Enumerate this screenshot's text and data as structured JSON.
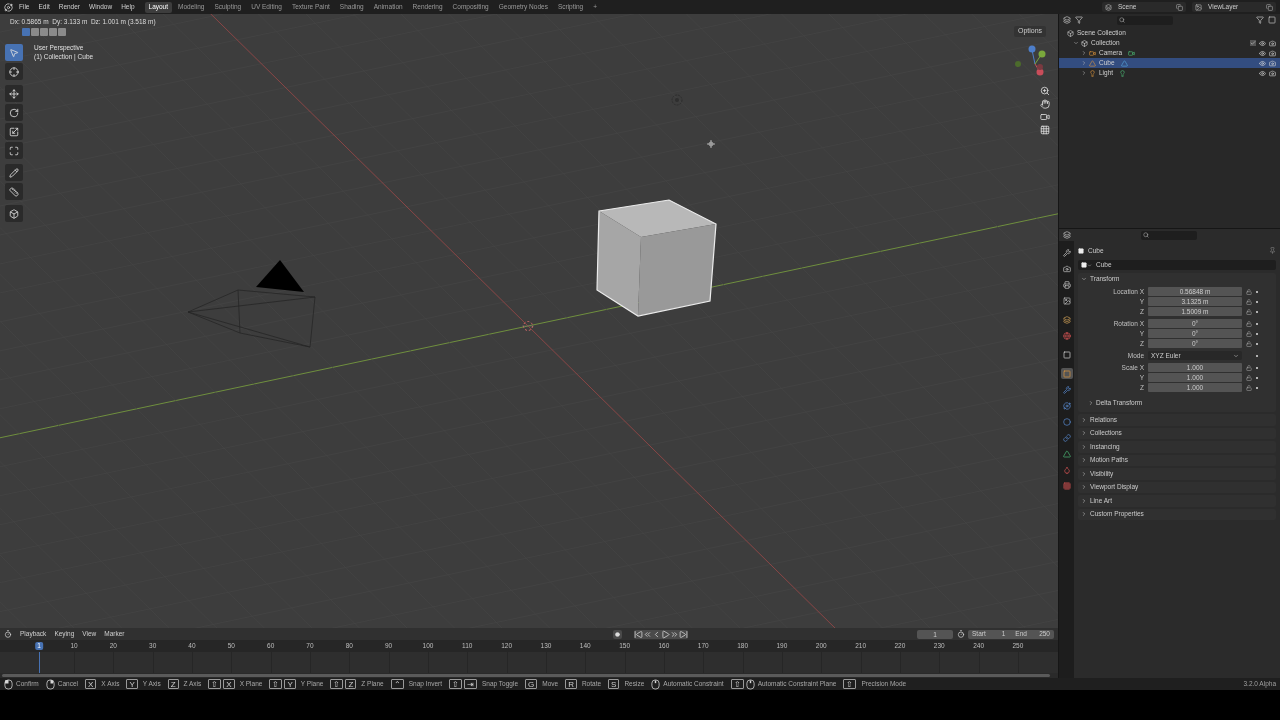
{
  "menu": [
    "File",
    "Edit",
    "Render",
    "Window",
    "Help"
  ],
  "workspaces": [
    {
      "label": "Layout",
      "selected": true
    },
    {
      "label": "Modeling",
      "selected": false
    },
    {
      "label": "Sculpting",
      "selected": false
    },
    {
      "label": "UV Editing",
      "selected": false
    },
    {
      "label": "Texture Paint",
      "selected": false
    },
    {
      "label": "Shading",
      "selected": false
    },
    {
      "label": "Animation",
      "selected": false
    },
    {
      "label": "Rendering",
      "selected": false
    },
    {
      "label": "Compositing",
      "selected": false
    },
    {
      "label": "Geometry Nodes",
      "selected": false
    },
    {
      "label": "Scripting",
      "selected": false
    },
    {
      "label": "+",
      "selected": false
    }
  ],
  "scene": "Scene",
  "view_layer": "ViewLayer",
  "viewport": {
    "header_text": "Dx: 0.5865 m  Dy: 3.133 m  Dz: 1.001 m (3.518 m)",
    "perspective": "User Perspective",
    "context": "(1) Collection | Cube",
    "options": "Options",
    "modes": [
      {
        "selected": true
      },
      {
        "selected": false
      },
      {
        "selected": false
      },
      {
        "selected": false
      },
      {
        "selected": false
      }
    ],
    "tools": [
      {
        "kind": "select",
        "selected": true
      },
      {
        "kind": "cursor",
        "selected": false
      },
      {
        "kind": "move",
        "selected": false
      },
      {
        "kind": "rotate",
        "selected": false
      },
      {
        "kind": "scale",
        "selected": false
      },
      {
        "kind": "transform",
        "selected": false
      },
      {
        "kind": "annotate",
        "selected": false
      },
      {
        "kind": "measure",
        "selected": false
      },
      {
        "kind": "add",
        "selected": false
      }
    ]
  },
  "outliner": {
    "items": [
      {
        "label": "Scene Collection",
        "kind": "scene",
        "selected": false,
        "children": [
          {
            "label": "Collection",
            "kind": "collection",
            "selected": false,
            "expanded": true,
            "visible": true,
            "renderable": true,
            "children": [
              {
                "label": "Camera",
                "kind": "camera",
                "selected": false,
                "expanded": false,
                "visible": true,
                "renderable": true
              },
              {
                "label": "Cube",
                "kind": "mesh",
                "selected": true,
                "expanded": false,
                "visible": true,
                "renderable": true
              },
              {
                "label": "Light",
                "kind": "light",
                "selected": false,
                "expanded": false,
                "visible": true,
                "renderable": true
              }
            ]
          }
        ]
      }
    ]
  },
  "properties": {
    "tabs": [
      {
        "kind": "tool",
        "selected": false
      },
      {
        "kind": "render",
        "selected": false
      },
      {
        "kind": "output",
        "selected": false
      },
      {
        "kind": "view_layer",
        "selected": false
      },
      {
        "kind": "scene",
        "selected": false
      },
      {
        "kind": "world",
        "selected": false
      },
      {
        "kind": "collection",
        "selected": false
      },
      {
        "kind": "object",
        "selected": true
      },
      {
        "kind": "modifiers",
        "selected": false
      },
      {
        "kind": "particles",
        "selected": false
      },
      {
        "kind": "physics",
        "selected": false
      },
      {
        "kind": "constraints",
        "selected": false
      },
      {
        "kind": "data",
        "selected": false
      },
      {
        "kind": "material",
        "selected": false
      },
      {
        "kind": "texture",
        "selected": false
      }
    ],
    "object": "Cube",
    "object_name": "Cube",
    "transform": {
      "label": "Transform",
      "expanded": true,
      "groups": [
        {
          "kind": "vector",
          "rows": [
            {
              "label": "Location X",
              "value": "0.56848 m"
            },
            {
              "label": "Y",
              "value": "3.1325 m"
            },
            {
              "label": "Z",
              "value": "1.5009 m"
            }
          ]
        },
        {
          "kind": "vector",
          "rows": [
            {
              "label": "Rotation X",
              "value": "0°"
            },
            {
              "label": "Y",
              "value": "0°"
            },
            {
              "label": "Z",
              "value": "0°"
            }
          ]
        },
        {
          "kind": "enum",
          "rows": [
            {
              "label": "Mode",
              "value": "XYZ Euler"
            }
          ]
        },
        {
          "kind": "vector",
          "rows": [
            {
              "label": "Scale X",
              "value": "1.000"
            },
            {
              "label": "Y",
              "value": "1.000"
            },
            {
              "label": "Z",
              "value": "1.000"
            }
          ]
        }
      ],
      "subpanel": {
        "label": "Delta Transform",
        "expanded": false
      }
    },
    "panels": [
      {
        "label": "Relations",
        "expanded": false
      },
      {
        "label": "Collections",
        "expanded": false
      },
      {
        "label": "Instancing",
        "expanded": false
      },
      {
        "label": "Motion Paths",
        "expanded": false
      },
      {
        "label": "Visibility",
        "expanded": false
      },
      {
        "label": "Viewport Display",
        "expanded": false
      },
      {
        "label": "Line Art",
        "expanded": false
      },
      {
        "label": "Custom Properties",
        "expanded": false
      }
    ]
  },
  "timeline": {
    "menus": [
      "Playback",
      "Keying",
      "View",
      "Marker"
    ],
    "current_frame": "1",
    "start_label": "Start",
    "start": "1",
    "end_label": "End",
    "end": "250",
    "ticks": [
      {
        "label": "1",
        "selected": true
      },
      {
        "label": "10",
        "selected": false
      },
      {
        "label": "20",
        "selected": false
      },
      {
        "label": "30",
        "selected": false
      },
      {
        "label": "40",
        "selected": false
      },
      {
        "label": "50",
        "selected": false
      },
      {
        "label": "60",
        "selected": false
      },
      {
        "label": "70",
        "selected": false
      },
      {
        "label": "80",
        "selected": false
      },
      {
        "label": "90",
        "selected": false
      },
      {
        "label": "100",
        "selected": false
      },
      {
        "label": "110",
        "selected": false
      },
      {
        "label": "120",
        "selected": false
      },
      {
        "label": "130",
        "selected": false
      },
      {
        "label": "140",
        "selected": false
      },
      {
        "label": "150",
        "selected": false
      },
      {
        "label": "160",
        "selected": false
      },
      {
        "label": "170",
        "selected": false
      },
      {
        "label": "180",
        "selected": false
      },
      {
        "label": "190",
        "selected": false
      },
      {
        "label": "200",
        "selected": false
      },
      {
        "label": "210",
        "selected": false
      },
      {
        "label": "220",
        "selected": false
      },
      {
        "label": "230",
        "selected": false
      },
      {
        "label": "240",
        "selected": false
      },
      {
        "label": "250",
        "selected": false
      }
    ]
  },
  "status": {
    "hints": [
      {
        "kind": "mouse-left",
        "label": "Confirm"
      },
      {
        "kind": "mouse-right",
        "label": "Cancel"
      },
      {
        "kind": "keys",
        "keys": [
          "X"
        ],
        "label": "X Axis"
      },
      {
        "kind": "keys",
        "keys": [
          "Y"
        ],
        "label": "Y Axis"
      },
      {
        "kind": "keys",
        "keys": [
          "Z"
        ],
        "label": "Z Axis"
      },
      {
        "kind": "keys",
        "keys": [
          "⇧",
          "X"
        ],
        "label": "X Plane"
      },
      {
        "kind": "keys",
        "keys": [
          "⇧",
          "Y"
        ],
        "label": "Y Plane"
      },
      {
        "kind": "keys",
        "keys": [
          "⇧",
          "Z"
        ],
        "label": "Z Plane"
      },
      {
        "kind": "keys",
        "keys": [
          "⌃"
        ],
        "label": "Snap Invert"
      },
      {
        "kind": "keys",
        "keys": [
          "⇧",
          "⇥"
        ],
        "label": "Snap Toggle"
      },
      {
        "kind": "keys",
        "keys": [
          "G"
        ],
        "label": "Move"
      },
      {
        "kind": "keys",
        "keys": [
          "R"
        ],
        "label": "Rotate"
      },
      {
        "kind": "keys",
        "keys": [
          "S"
        ],
        "label": "Resize"
      },
      {
        "kind": "mouse-middle",
        "label": "Automatic Constraint"
      },
      {
        "kind": "mouse-middle",
        "keys": [
          "⇧"
        ],
        "label": "Automatic Constraint Plane"
      },
      {
        "kind": "keys",
        "keys": [
          "⇧"
        ],
        "label": "Precision Mode"
      }
    ],
    "version": "3.2.0 Alpha"
  }
}
